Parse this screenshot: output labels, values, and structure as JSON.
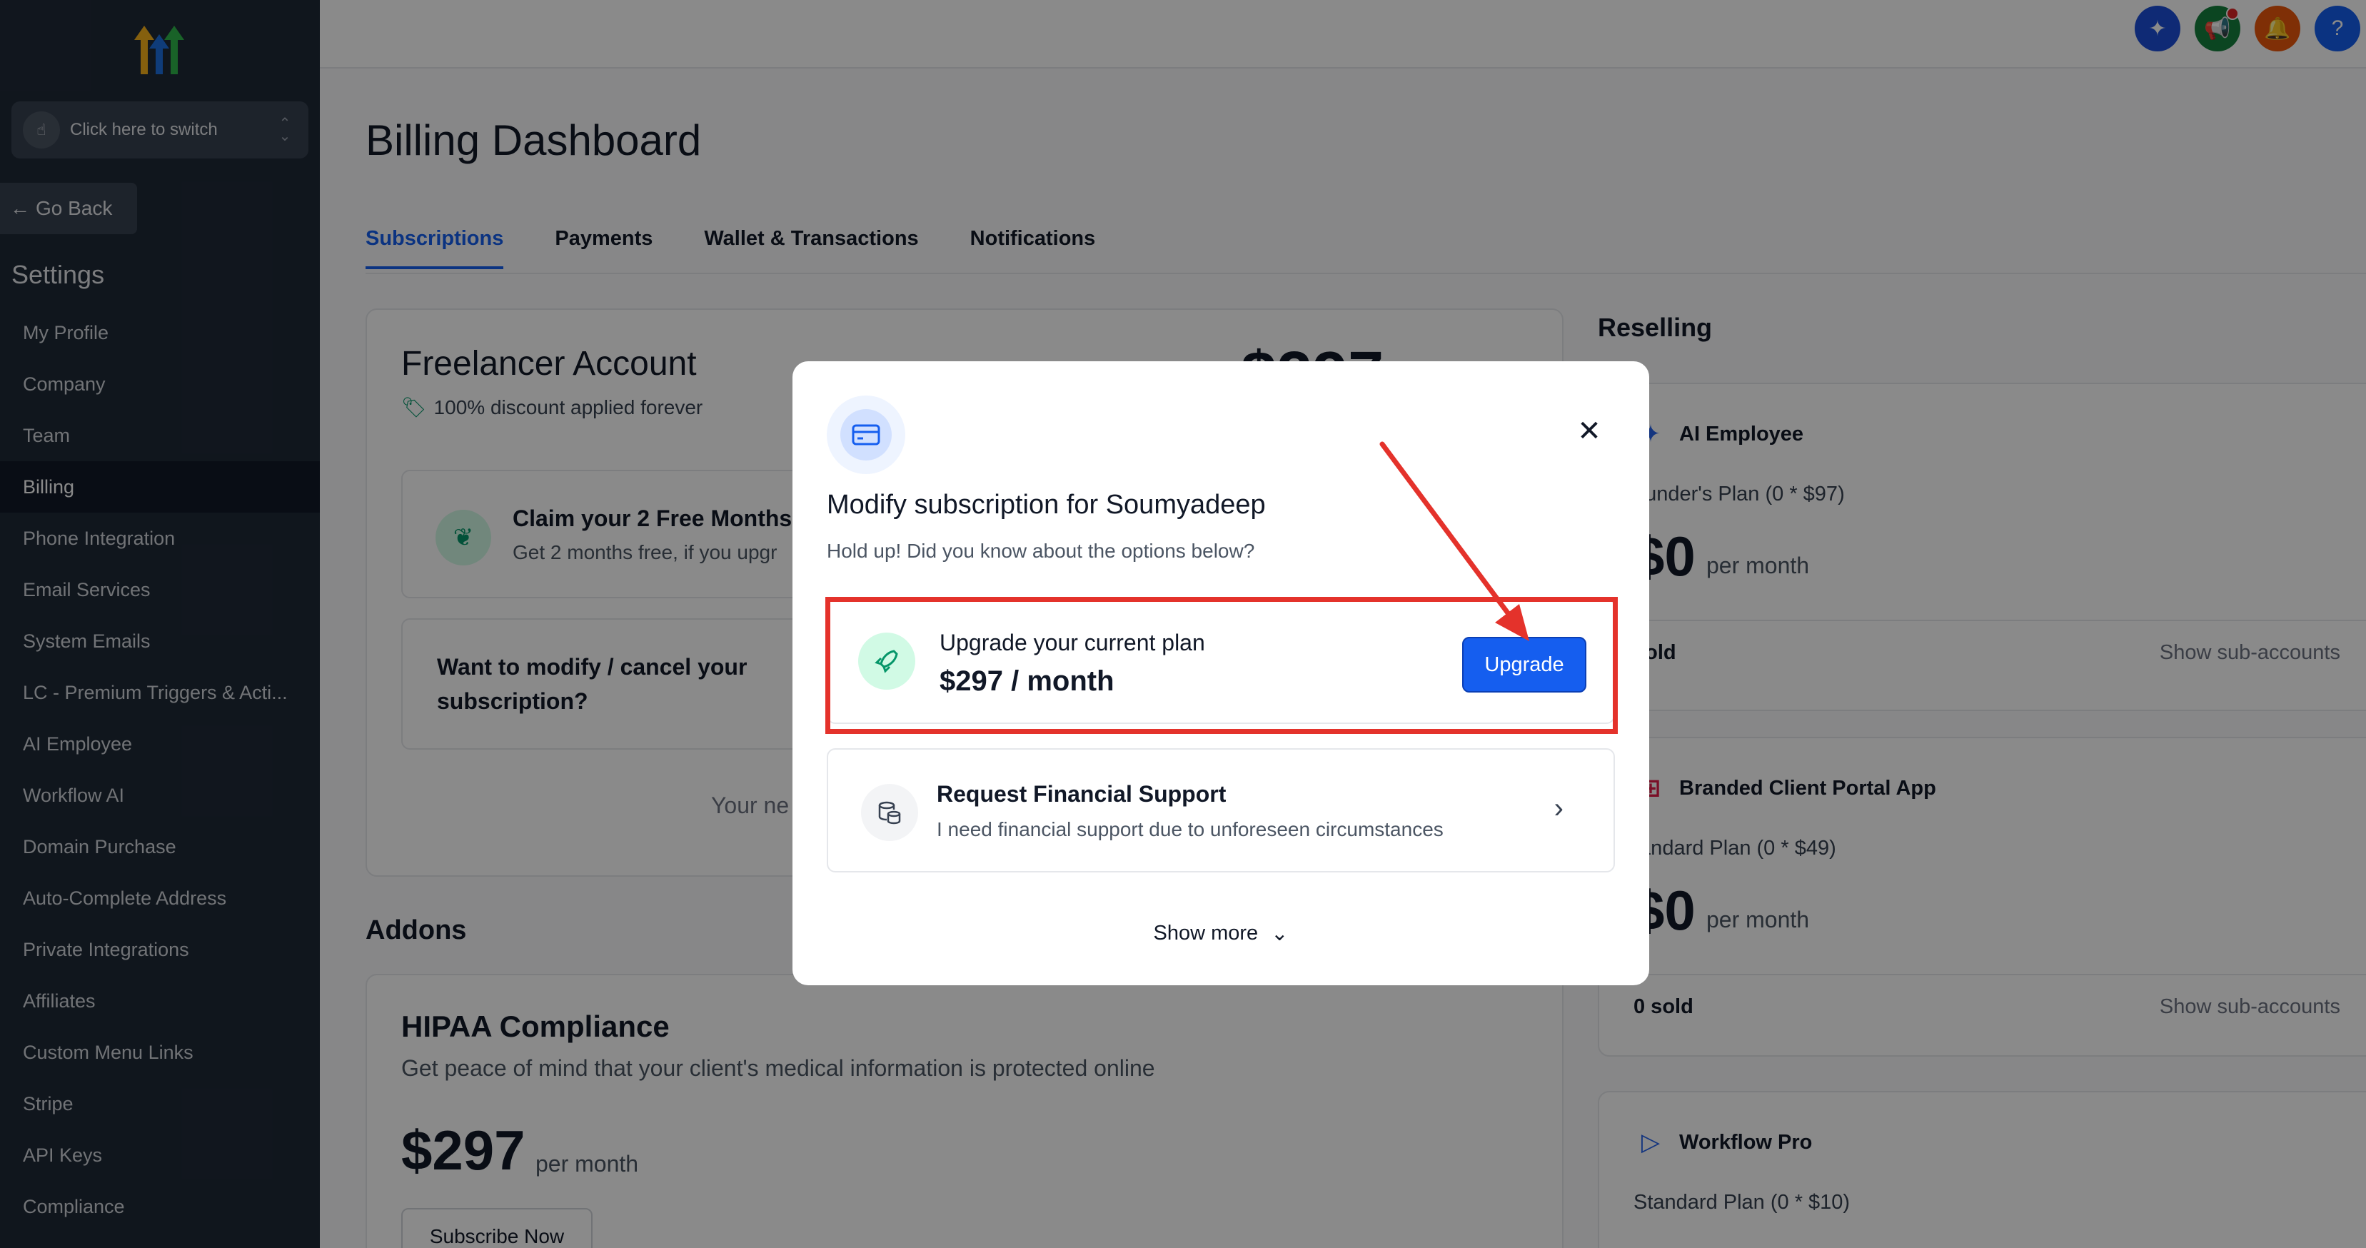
{
  "sidebar": {
    "switcher_label": "Click here to switch",
    "go_back": "Go Back",
    "settings_title": "Settings",
    "items": [
      {
        "label": "My Profile"
      },
      {
        "label": "Company"
      },
      {
        "label": "Team"
      },
      {
        "label": "Billing",
        "active": true
      },
      {
        "label": "Phone Integration"
      },
      {
        "label": "Email Services"
      },
      {
        "label": "System Emails"
      },
      {
        "label": "LC - Premium Triggers & Acti..."
      },
      {
        "label": "AI Employee"
      },
      {
        "label": "Workflow AI"
      },
      {
        "label": "Domain Purchase"
      },
      {
        "label": "Auto-Complete Address"
      },
      {
        "label": "Private Integrations"
      },
      {
        "label": "Affiliates"
      },
      {
        "label": "Custom Menu Links"
      },
      {
        "label": "Stripe"
      },
      {
        "label": "API Keys"
      },
      {
        "label": "Compliance"
      }
    ]
  },
  "header": {
    "icons": [
      {
        "name": "ai-sparkle-icon",
        "color": "#1d4ed8"
      },
      {
        "name": "megaphone-icon",
        "color": "#15803d",
        "badge": true
      },
      {
        "name": "bell-icon",
        "color": "#ea580c"
      },
      {
        "name": "help-icon",
        "color": "#155eef",
        "glyph": "?"
      }
    ]
  },
  "main": {
    "title": "Billing Dashboard",
    "tabs": [
      {
        "label": "Subscriptions",
        "active": true
      },
      {
        "label": "Payments"
      },
      {
        "label": "Wallet & Transactions"
      },
      {
        "label": "Notifications"
      }
    ],
    "account": {
      "title": "Freelancer Account",
      "price": "$297",
      "discount": "100% discount applied forever",
      "claim_title": "Claim your 2 Free Months",
      "claim_sub": "Get 2 months free, if you upgr",
      "modify_text": "Want to modify / cancel your subscription?",
      "your_next": "Your ne"
    },
    "addons_title": "Addons",
    "hipaa": {
      "title": "HIPAA Compliance",
      "desc": "Get peace of mind that your client's medical information is protected online",
      "price": "$297",
      "per": "per month",
      "subscribe": "Subscribe Now"
    }
  },
  "reselling": {
    "title": "Reselling",
    "cards": [
      {
        "name": "AI Employee",
        "plan": "ounder's Plan (0 * $97)",
        "price": "$0",
        "per": "per month",
        "sold": "sold",
        "show": "Show sub-accounts"
      },
      {
        "name": "Branded Client Portal App",
        "plan": "tandard Plan (0 * $49)",
        "price": "$0",
        "per": "per month",
        "sold": "0 sold",
        "show": "Show sub-accounts"
      },
      {
        "name": "Workflow Pro",
        "plan": "Standard Plan (0 * $10)"
      }
    ]
  },
  "modal": {
    "title": "Modify subscription for Soumyadeep",
    "subtitle": "Hold up! Did you know about the options below?",
    "upgrade": {
      "title": "Upgrade your current plan",
      "price": "$297 / month",
      "button": "Upgrade"
    },
    "support": {
      "title": "Request Financial Support",
      "desc": "I need financial support due to unforeseen circumstances"
    },
    "show_more": "Show more"
  },
  "colors": {
    "accent": "#155eef",
    "annotation": "#e4322b"
  }
}
